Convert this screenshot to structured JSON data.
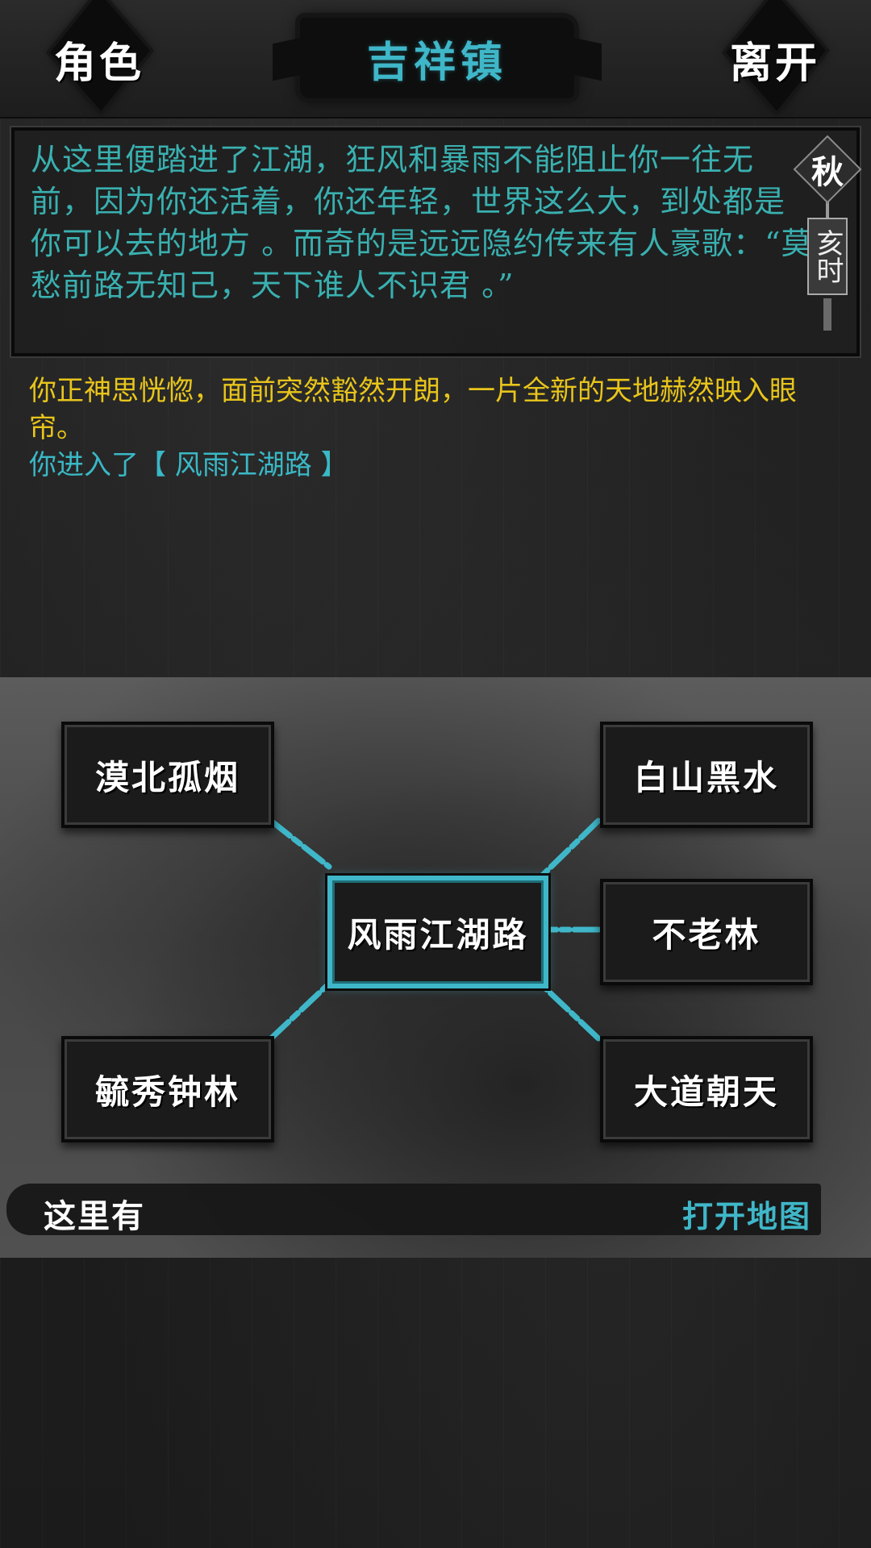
{
  "header": {
    "role_button": "角色",
    "leave_button": "离开",
    "town_title": "吉祥镇"
  },
  "narration": {
    "text": "从这里便踏进了江湖，狂风和暴雨不能阻止你一往无前，因为你还活着，你还年轻，世界这么大，到处都是你可以去的地方 。而奇的是远远隐约传来有人豪歌：“莫愁前路无知己，天下谁人不识君 。”",
    "season": "秋",
    "time": "亥时"
  },
  "log": {
    "line1": "你正神思恍惚，面前突然豁然开朗，一片全新的天地赫然映入眼帘。",
    "line2": "你进入了【 风雨江湖路 】"
  },
  "map": {
    "current": "风雨江湖路",
    "locations": {
      "top_left": "漠北孤烟",
      "bottom_left": "毓秀钟林",
      "top_right": "白山黑水",
      "mid_right": "不老林",
      "bottom_right": "大道朝天"
    },
    "here_label": "这里有",
    "open_map": "打开地图"
  },
  "colors": {
    "accent_teal": "#3fb7c9",
    "narration_text": "#3ab0b0",
    "log_yellow": "#e8c51b"
  }
}
